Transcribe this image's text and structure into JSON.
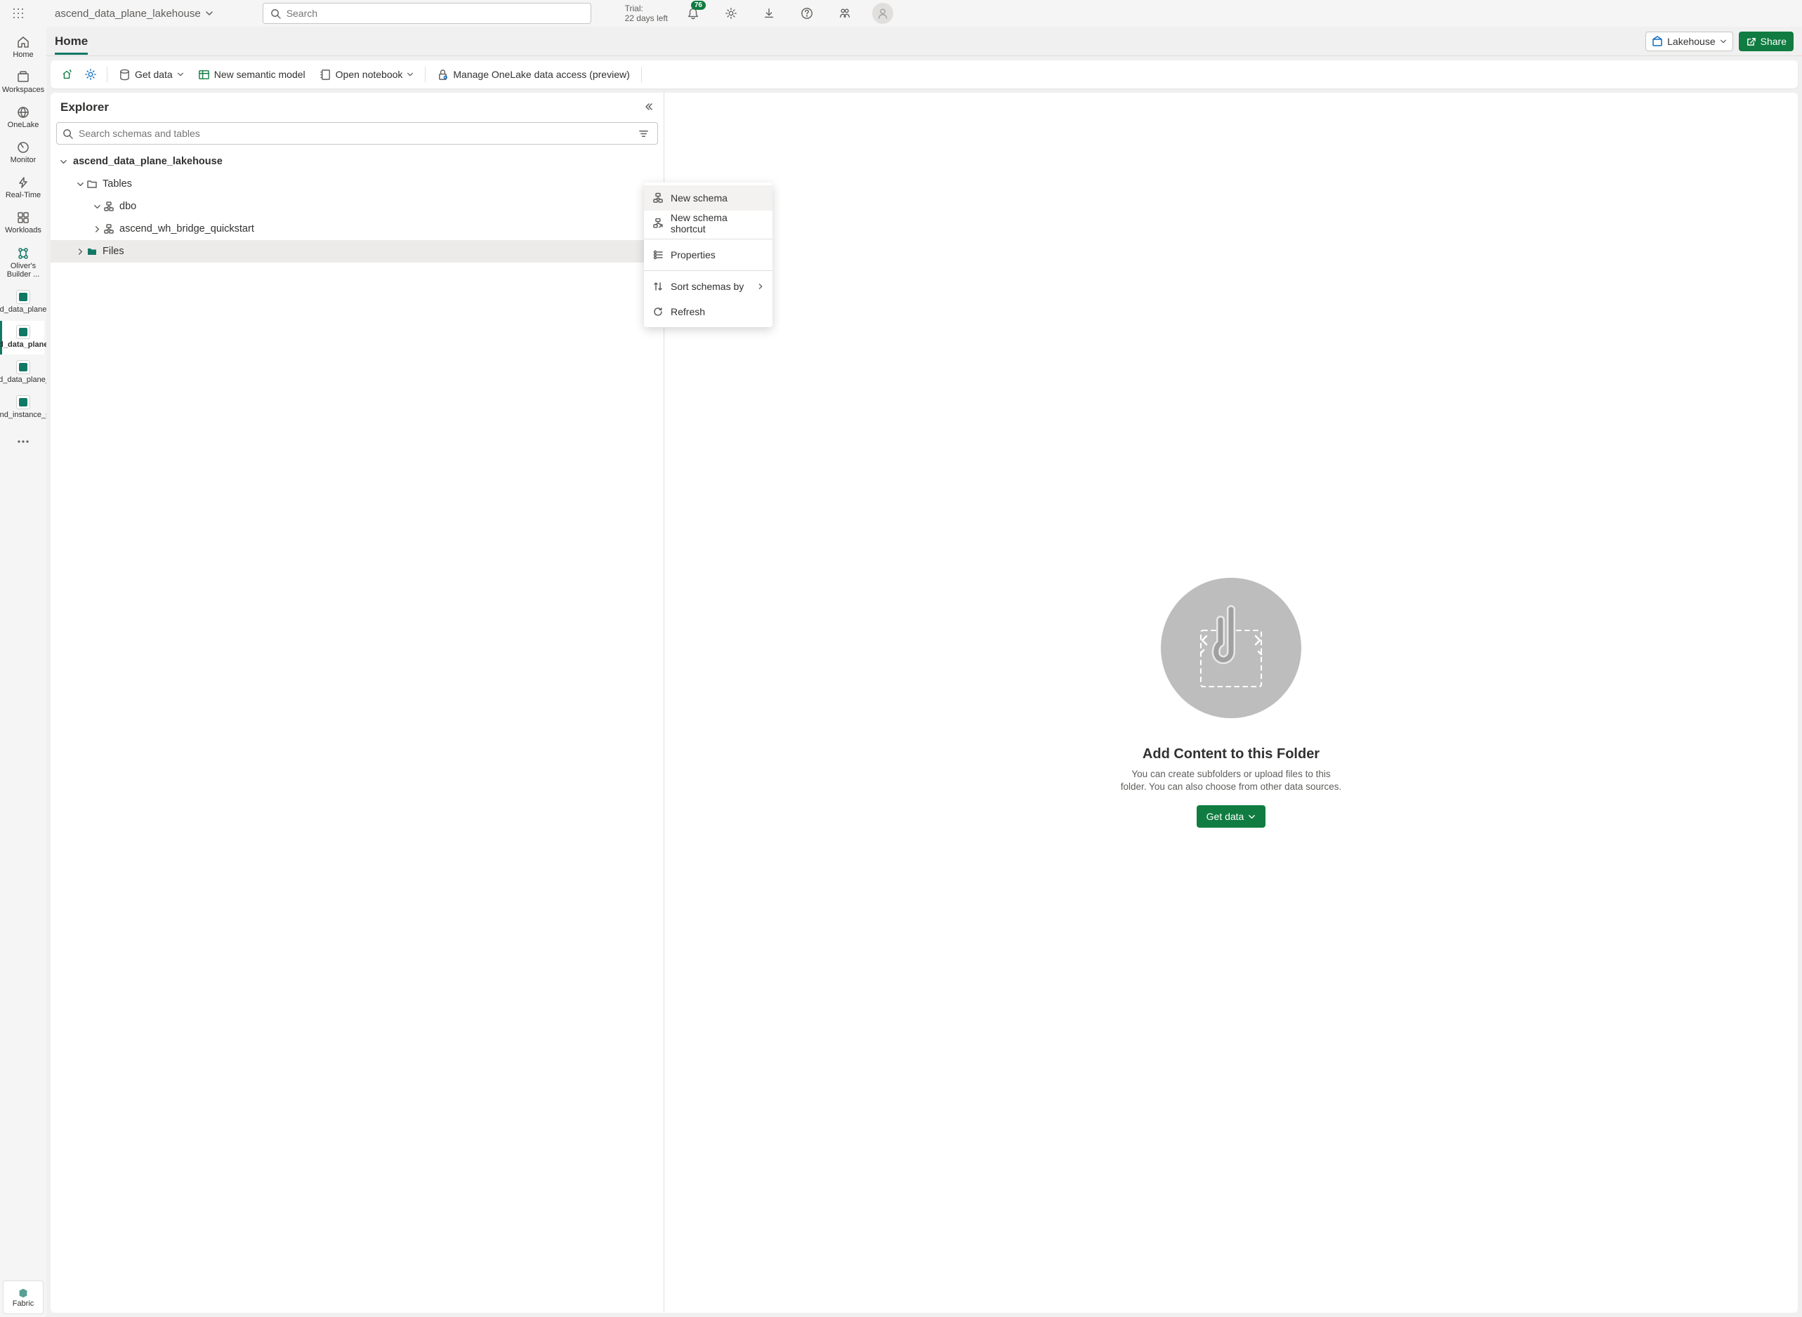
{
  "header": {
    "workspace_name": "ascend_data_plane_lakehouse",
    "search_placeholder": "Search",
    "trial_line1": "Trial:",
    "trial_line2": "22 days left",
    "notification_count": "76"
  },
  "left_nav": {
    "items": [
      {
        "label": "Home"
      },
      {
        "label": "Workspaces"
      },
      {
        "label": "OneLake"
      },
      {
        "label": "Monitor"
      },
      {
        "label": "Real-Time"
      },
      {
        "label": "Workloads"
      },
      {
        "label": "Oliver's Builder ..."
      },
      {
        "label": "ascend_data_plane_lak..."
      },
      {
        "label": "ascend_data_plane_lak..."
      },
      {
        "label": "ascend_data_plane_war..."
      },
      {
        "label": "ascend_instance_store"
      }
    ],
    "fabric_label": "Fabric"
  },
  "home_bar": {
    "tab": "Home",
    "lakehouse_label": "Lakehouse",
    "share_label": "Share"
  },
  "toolbar": {
    "get_data": "Get data",
    "semantic_model": "New semantic model",
    "open_notebook": "Open notebook",
    "manage_access": "Manage OneLake data access (preview)"
  },
  "explorer": {
    "title": "Explorer",
    "search_placeholder": "Search schemas and tables",
    "root": "ascend_data_plane_lakehouse",
    "tables_label": "Tables",
    "schema1": "dbo",
    "schema2": "ascend_wh_bridge_quickstart",
    "files_label": "Files"
  },
  "context_menu": {
    "new_schema": "New schema",
    "new_schema_shortcut": "New schema shortcut",
    "properties": "Properties",
    "sort_schemas": "Sort schemas by",
    "refresh": "Refresh"
  },
  "preview": {
    "title": "Add Content to this Folder",
    "desc": "You can create subfolders or upload files to this folder. You can also choose from other data sources.",
    "button": "Get data"
  }
}
